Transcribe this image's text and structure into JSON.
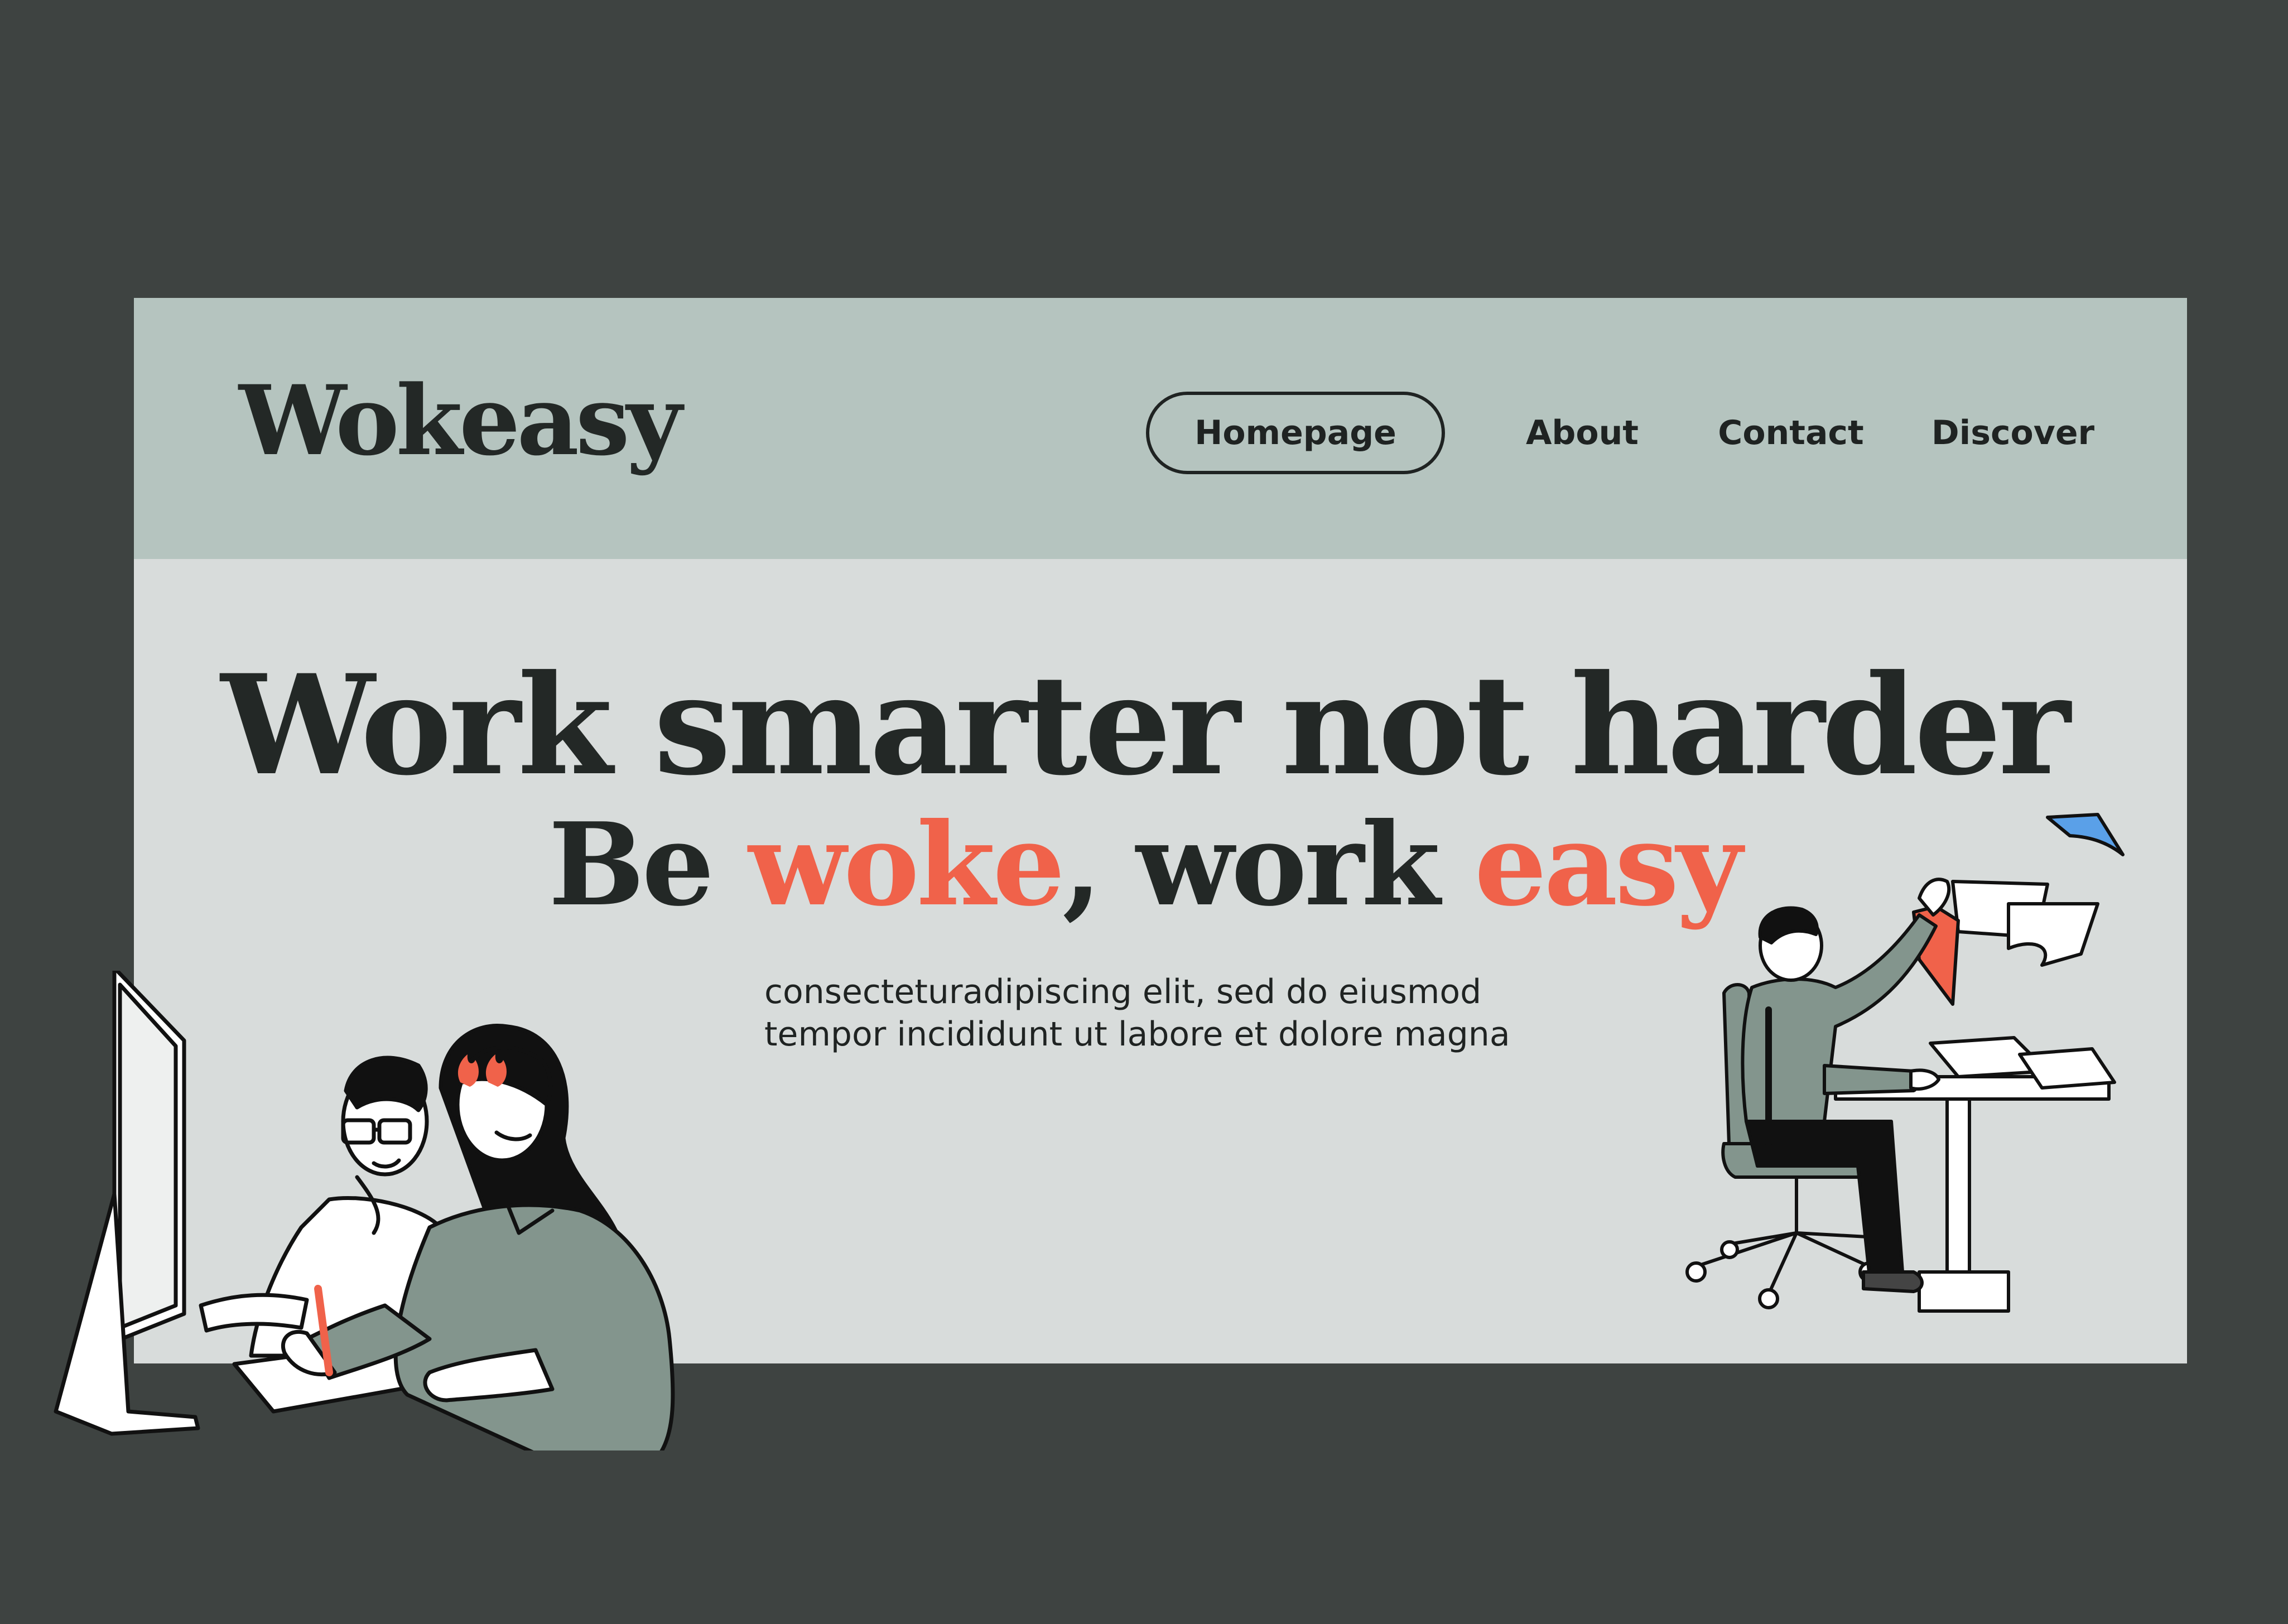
{
  "brand": {
    "name": "Wokeasy"
  },
  "nav": {
    "items": [
      {
        "label": "Homepage",
        "active": true
      },
      {
        "label": "About",
        "active": false
      },
      {
        "label": "Contact",
        "active": false
      },
      {
        "label": "Discover",
        "active": false
      }
    ]
  },
  "hero": {
    "headline": "Work smarter not harder",
    "subheadline": {
      "prefix": "Be ",
      "accent1": "woke",
      "middle": ", work ",
      "accent2": "easy"
    },
    "description_line1": "consecteturadipiscing elit, sed do eiusmod",
    "description_line2": "tempor incididunt ut labore et dolore magna"
  },
  "colors": {
    "page_background": "#3e4341",
    "card_background": "#d8dcdb",
    "header_background": "#b5c4bf",
    "text_dark": "#232826",
    "accent": "#f0624a",
    "sage": "#83958d"
  }
}
